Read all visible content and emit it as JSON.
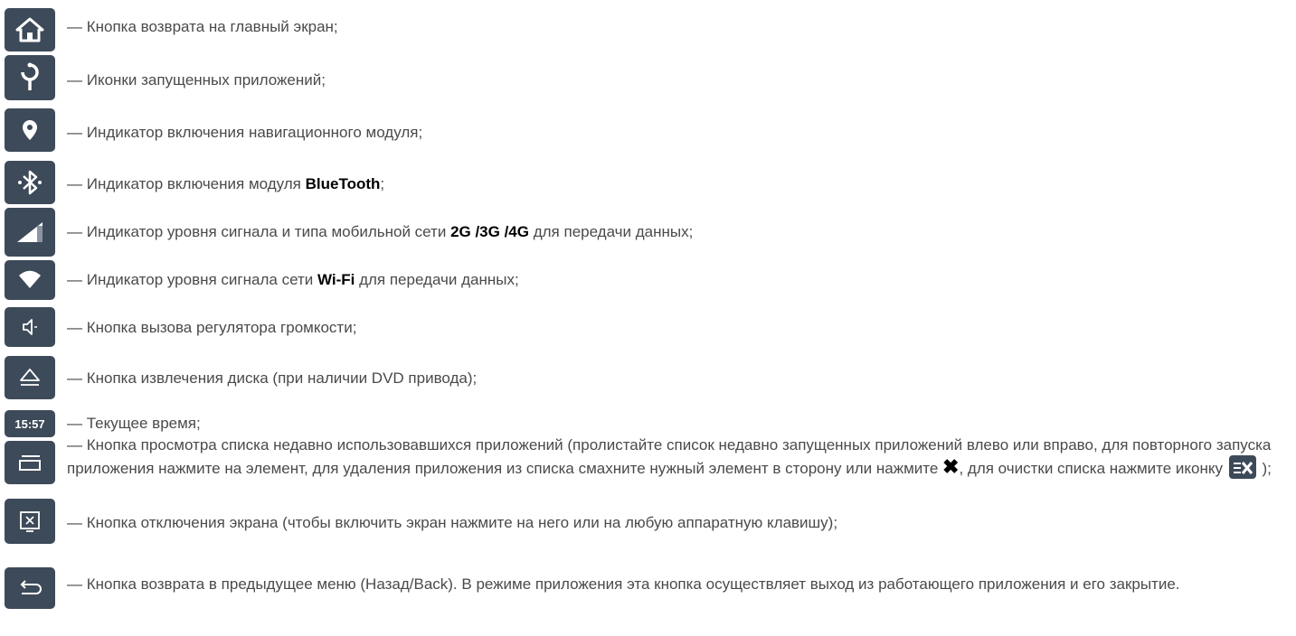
{
  "items": [
    {
      "icon": "home-icon",
      "text": "— Кнопка возврата на главный экран;"
    },
    {
      "icon": "running-app-icon",
      "text": "— Иконки запущенных приложений;"
    },
    {
      "icon": "location-pin-icon",
      "text": "— Индикатор включения навигационного модуля;"
    },
    {
      "icon": "bluetooth-icon",
      "text_before": "— Индикатор включения модуля ",
      "highlight": "BlueTooth",
      "text_after": ";"
    },
    {
      "icon": "cellular-signal-icon",
      "text_before": "— Индикатор уровня сигнала и типа мобильной сети ",
      "highlight": "2G /3G /4G",
      "text_after": " для передачи данных;"
    },
    {
      "icon": "wifi-icon",
      "text_before": "— Индикатор уровня сигнала сети ",
      "highlight": "Wi-Fi",
      "text_after": " для передачи данных;"
    },
    {
      "icon": "volume-icon",
      "text": "— Кнопка вызова регулятора громкости;"
    },
    {
      "icon": "eject-icon",
      "text": "— Кнопка извлечения диска (при наличии DVD привода);"
    },
    {
      "icon": "clock-tile",
      "time": "15:57",
      "text": "— Текущее время;"
    },
    {
      "icon": "recent-apps-icon",
      "text_before": "— Кнопка просмотра списка недавно использовавшихся приложений (пролистайте список недавно запущенных приложений влево или вправо, для повторного запуска приложения нажмите на элемент, для удаления приложения из списка смахните нужный элемент в сторону или нажмите ",
      "x_symbol": "✖",
      "text_middle": ", для очистки списка нажмите иконку ",
      "text_after": " );"
    },
    {
      "icon": "screen-off-icon",
      "text": "— Кнопка отключения экрана (чтобы включить экран нажмите на него или на любую аппаратную клавишу);"
    },
    {
      "icon": "back-icon",
      "text": "— Кнопка возврата в предыдущее меню (Назад/Back). В режиме приложения эта кнопка осуществляет выход из работающего приложения и его закрытие."
    }
  ],
  "colors": {
    "tile": "#3d4a59",
    "text": "#4a4a4a",
    "highlight": "#000000"
  }
}
